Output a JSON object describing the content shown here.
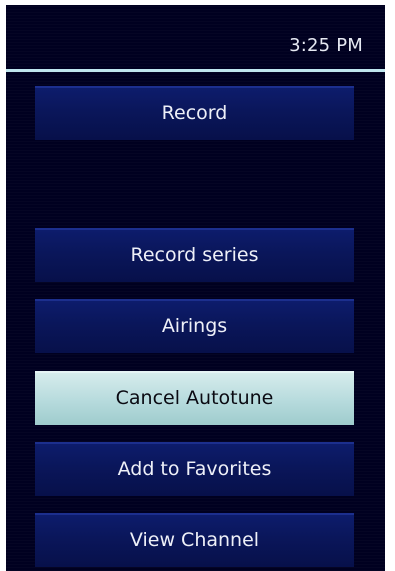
{
  "header": {
    "time": "3:25 PM"
  },
  "menu": {
    "record": "Record",
    "record_series": "Record series",
    "airings": "Airings",
    "cancel_autotune": "Cancel Autotune",
    "add_to_favorites": "Add to Favorites",
    "view_channel": "View Channel",
    "selected": "Cancel Autotune"
  },
  "colors": {
    "background": "#000020",
    "button": "#0a165a",
    "button_selected": "#b9dcde",
    "divider": "#bfe6ee",
    "text": "#eef0f8"
  }
}
